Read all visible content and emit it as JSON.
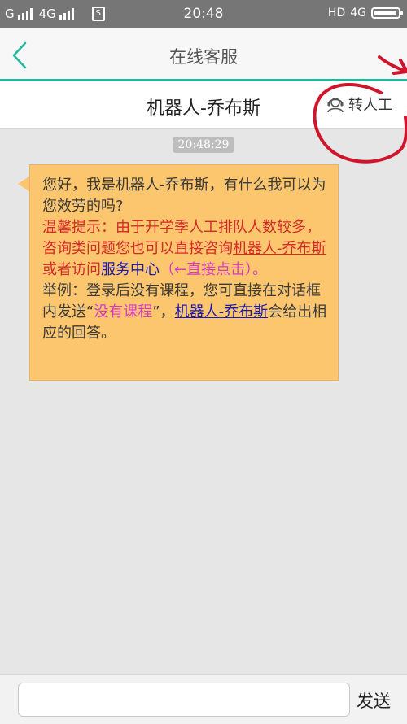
{
  "status_bar": {
    "carrier_left": "G",
    "network_label": "4G",
    "time": "20:48",
    "hd_label": "HD",
    "network_right": "4G",
    "battery_level": 0.95
  },
  "header": {
    "title": "在线客服"
  },
  "subheader": {
    "agent_name": "机器人-乔布斯",
    "transfer_label": "转人工"
  },
  "chat": {
    "timestamp": "20:48:29",
    "message": {
      "greeting": "您好，我是机器人-乔布斯，有什么我可以为您效劳的吗?",
      "tip_prefix": "温馨提示：由于开学季人工排队人数较多，咨询类问题您也可以直接咨询",
      "tip_bot_link": "机器人-乔布斯",
      "tip_middle": "或者访问",
      "tip_service_link": "服务中心",
      "tip_hint": "（←直接点击）。",
      "example_prefix": "举例：登录后没有课程，您可直接在对话框内发送“",
      "example_keyword": "没有课程",
      "example_middle": "”，",
      "example_bot_link": "机器人-乔布斯",
      "example_suffix": "会给出相应的回答。"
    }
  },
  "input_bar": {
    "placeholder": "",
    "send_label": "发送"
  },
  "colors": {
    "accent": "#1fb89a",
    "bubble": "#fcc66e",
    "warning_text": "#d32a2a",
    "link_text": "#1a1ab0",
    "highlight_text": "#d63bc1",
    "annotation": "#d0142c"
  }
}
